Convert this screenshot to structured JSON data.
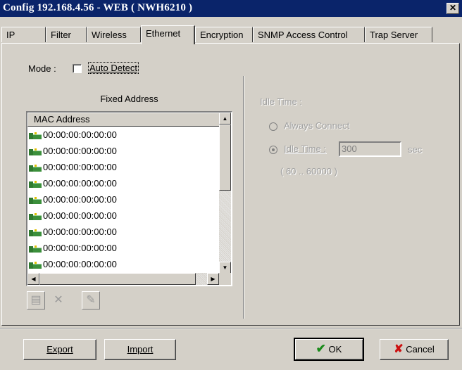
{
  "window": {
    "title": "Config 192.168.4.56 - WEB ( NWH6210 )",
    "close_glyph": "✕"
  },
  "tabs": [
    {
      "label": "IP"
    },
    {
      "label": "Filter"
    },
    {
      "label": "Wireless"
    },
    {
      "label": "Ethernet",
      "active": true
    },
    {
      "label": "Encryption"
    },
    {
      "label": "SNMP Access Control"
    },
    {
      "label": "Trap Server"
    }
  ],
  "mode": {
    "label": "Mode :",
    "auto_detect_label": "Auto Detect",
    "auto_detect_checked": false
  },
  "fixed_address": {
    "title": "Fixed Address",
    "column_header": "MAC Address",
    "rows": [
      "00:00:00:00:00:00",
      "00:00:00:00:00:00",
      "00:00:00:00:00:00",
      "00:00:00:00:00:00",
      "00:00:00:00:00:00",
      "00:00:00:00:00:00",
      "00:00:00:00:00:00",
      "00:00:00:00:00:00",
      "00:00:00:00:00:00"
    ],
    "row_icon": "network-card-icon",
    "toolbar_icons": [
      "properties-icon",
      "delete-icon",
      "edit-icon"
    ]
  },
  "idle": {
    "group_label": "Idle Time :",
    "always_connect_label": "Always Connect",
    "idle_time_label": "Idle Time :",
    "idle_time_value": "300",
    "unit": "sec",
    "range": "( 60 .. 60000 )",
    "selected": "idle_time",
    "disabled": true
  },
  "buttons": {
    "export": "Export",
    "import": "Import",
    "ok": "OK",
    "cancel": "Cancel"
  },
  "colors": {
    "titlebar": "#0a246a",
    "face": "#d4d0c8",
    "ok_check": "#1a8a1a",
    "cancel_x": "#cc1111"
  }
}
